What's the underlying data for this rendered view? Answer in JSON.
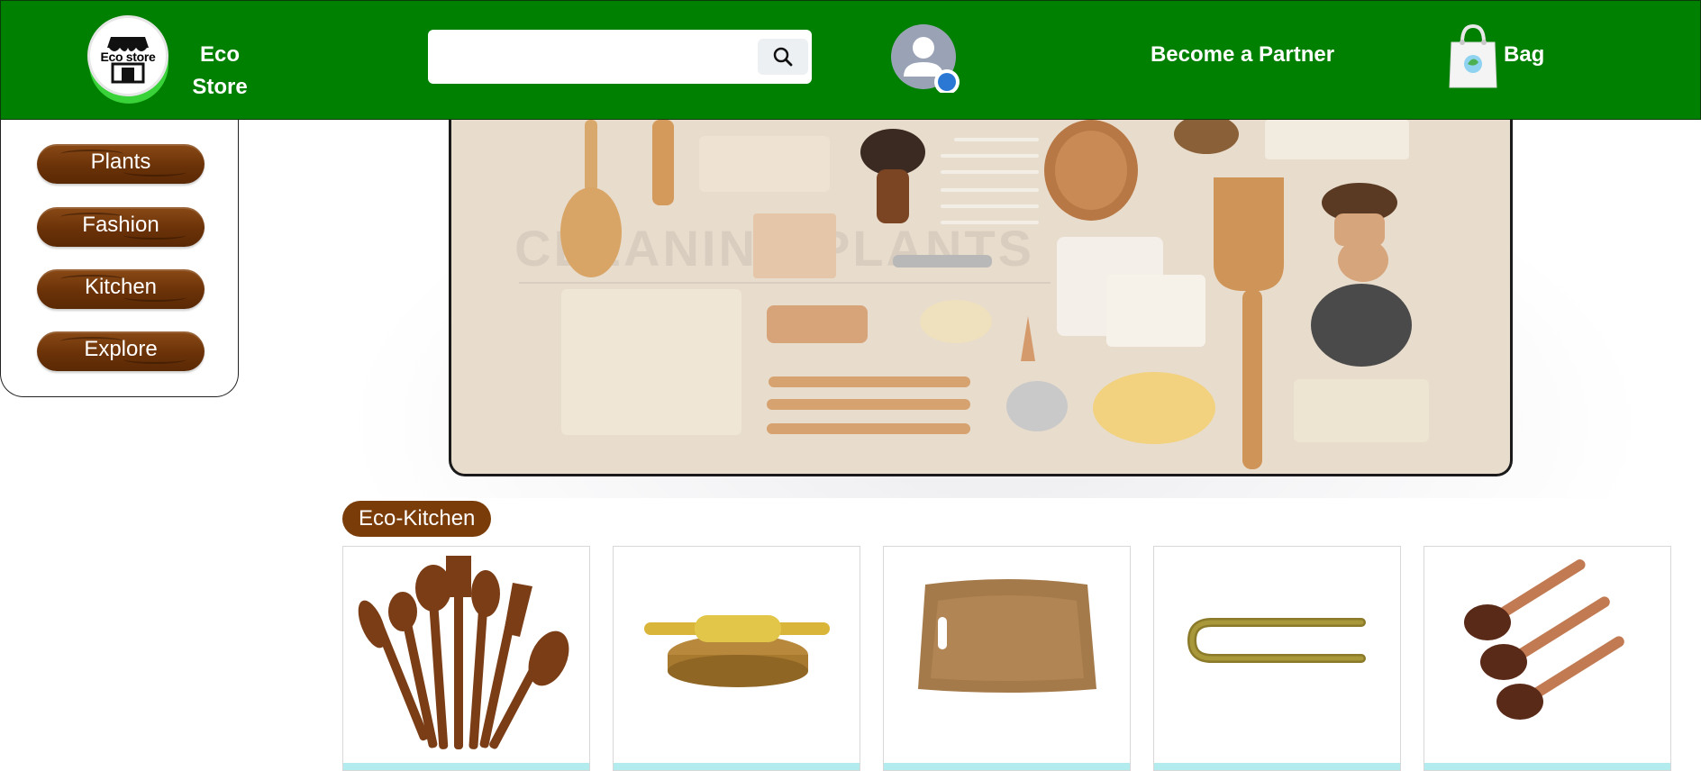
{
  "header": {
    "logo_text": "Eco store",
    "brand_line1": "Eco",
    "brand_line2": "Store",
    "search": {
      "value": "",
      "placeholder": ""
    },
    "partner_label": "Become a Partner",
    "bag_label": "Bag",
    "colors": {
      "background": "#008000",
      "text": "#ffffff"
    }
  },
  "sidebar": {
    "items": [
      {
        "label": "Plants"
      },
      {
        "label": "Fashion"
      },
      {
        "label": "Kitchen"
      },
      {
        "label": "Explore"
      }
    ],
    "button_color": "#6b3208"
  },
  "banner": {
    "watermark": "CLEANING PLANTS",
    "image": "eco-products-flatlay"
  },
  "section": {
    "title": "Eco-Kitchen",
    "products": [
      {
        "image": "wooden-spatula-set"
      },
      {
        "image": "rolling-pin-and-board"
      },
      {
        "image": "wooden-cutting-board"
      },
      {
        "image": "bamboo-tongs"
      },
      {
        "image": "coconut-shell-spoons"
      }
    ]
  },
  "icons": {
    "search": "search-icon",
    "avatar": "user-avatar-icon",
    "bag": "shopping-bag-icon",
    "store": "store-icon"
  }
}
